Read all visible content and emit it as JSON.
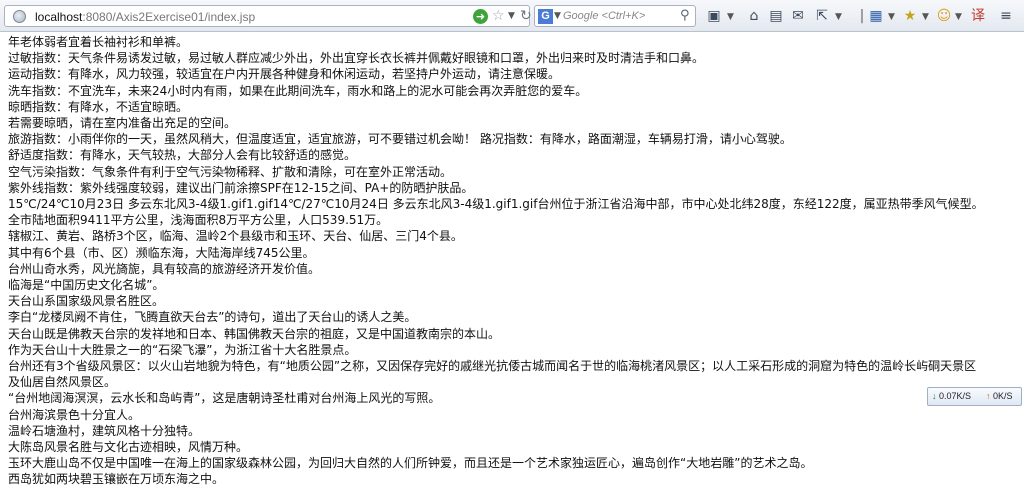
{
  "browser": {
    "url_host": "localhost",
    "url_rest": ":8080/Axis2Exercise01/index.jsp",
    "search_engine_icon": "google-icon",
    "search_engine_letter": "G",
    "search_placeholder": "Google <Ctrl+K>"
  },
  "toolbar_icons": [
    "screenshot-icon",
    "home-icon",
    "bookmark-icon",
    "mail-icon",
    "share-icon",
    "grid-icon",
    "star-icon",
    "emoji-icon",
    "translate-icon",
    "menu-icon"
  ],
  "network": {
    "down": "0.07K/S",
    "up": "0K/S"
  },
  "lines": [
    "年老体弱者宜着长袖衬衫和单裤。",
    "过敏指数：天气条件易诱发过敏，易过敏人群应减少外出，外出宜穿长衣长裤并佩戴好眼镜和口罩，外出归来时及时清洁手和口鼻。",
    "运动指数：有降水，风力较强，较适宜在户内开展各种健身和休闲运动，若坚持户外运动，请注意保暖。",
    "洗车指数：不宜洗车，未来24小时内有雨，如果在此期间洗车，雨水和路上的泥水可能会再次弄脏您的爱车。",
    "晾晒指数：有降水，不适宜晾晒。",
    "若需要晾晒，请在室内准备出充足的空间。",
    "旅游指数：小雨伴你的一天，虽然风稍大，但温度适宜，适宜旅游，可不要错过机会呦！ 路况指数：有降水，路面潮湿，车辆易打滑，请小心驾驶。",
    "舒适度指数：有降水，天气较热，大部分人会有比较舒适的感觉。",
    "空气污染指数：气象条件有利于空气污染物稀释、扩散和清除，可在室外正常活动。",
    "紫外线指数：紫外线强度较弱，建议出门前涂擦SPF在12-15之间、PA+的防晒护肤品。",
    "15℃/24℃10月23日 多云东北风3-4级1.gif1.gif14℃/27℃10月24日 多云东北风3-4级1.gif1.gif台州位于浙江省沿海中部，市中心处北纬28度，东经122度，属亚热带季风气候型。",
    "全市陆地面积9411平方公里，浅海面积8万平方公里，人口539.51万。",
    "辖椒江、黄岩、路桥3个区，临海、温岭2个县级市和玉环、天台、仙居、三门4个县。",
    "其中有6个县（市、区）濒临东海，大陆海岸线745公里。",
    "台州山奇水秀，风光旖旎，具有较高的旅游经济开发价值。",
    "临海是“中国历史文化名城”。",
    "天台山系国家级风景名胜区。",
    "李白“龙楼凤阙不肯住，飞腾直欲天台去”的诗句，道出了天台山的诱人之美。",
    "天台山既是佛教天台宗的发祥地和日本、韩国佛教天台宗的祖庭，又是中国道教南宗的本山。",
    "作为天台山十大胜景之一的“石梁飞瀑”，为浙江省十大名胜景点。",
    "台州还有3个省级风景区：以火山岩地貌为特色，有“地质公园”之称，又因保存完好的戚继光抗倭古城而闻名于世的临海桃渚风景区；以人工采石形成的洞窟为特色的温岭长屿硐天景区",
    "及仙居自然风景区。",
    "“台州地阔海溟溟，云水长和岛屿青”，这是唐朝诗圣杜甫对台州海上风光的写照。",
    "台州海滨景色十分宜人。",
    "温岭石塘渔村，建筑风格十分独特。",
    "大陈岛风景名胜与文化古迹相映，风情万种。",
    "玉环大鹿山岛不仅是中国唯一在海上的国家级森林公园，为回归大自然的人们所钟爱，而且还是一个艺术家独运匠心，遍岛创作“大地岩雕”的艺术之岛。",
    "西岛犹如两块碧玉镶嵌在万顷东海之中。"
  ]
}
